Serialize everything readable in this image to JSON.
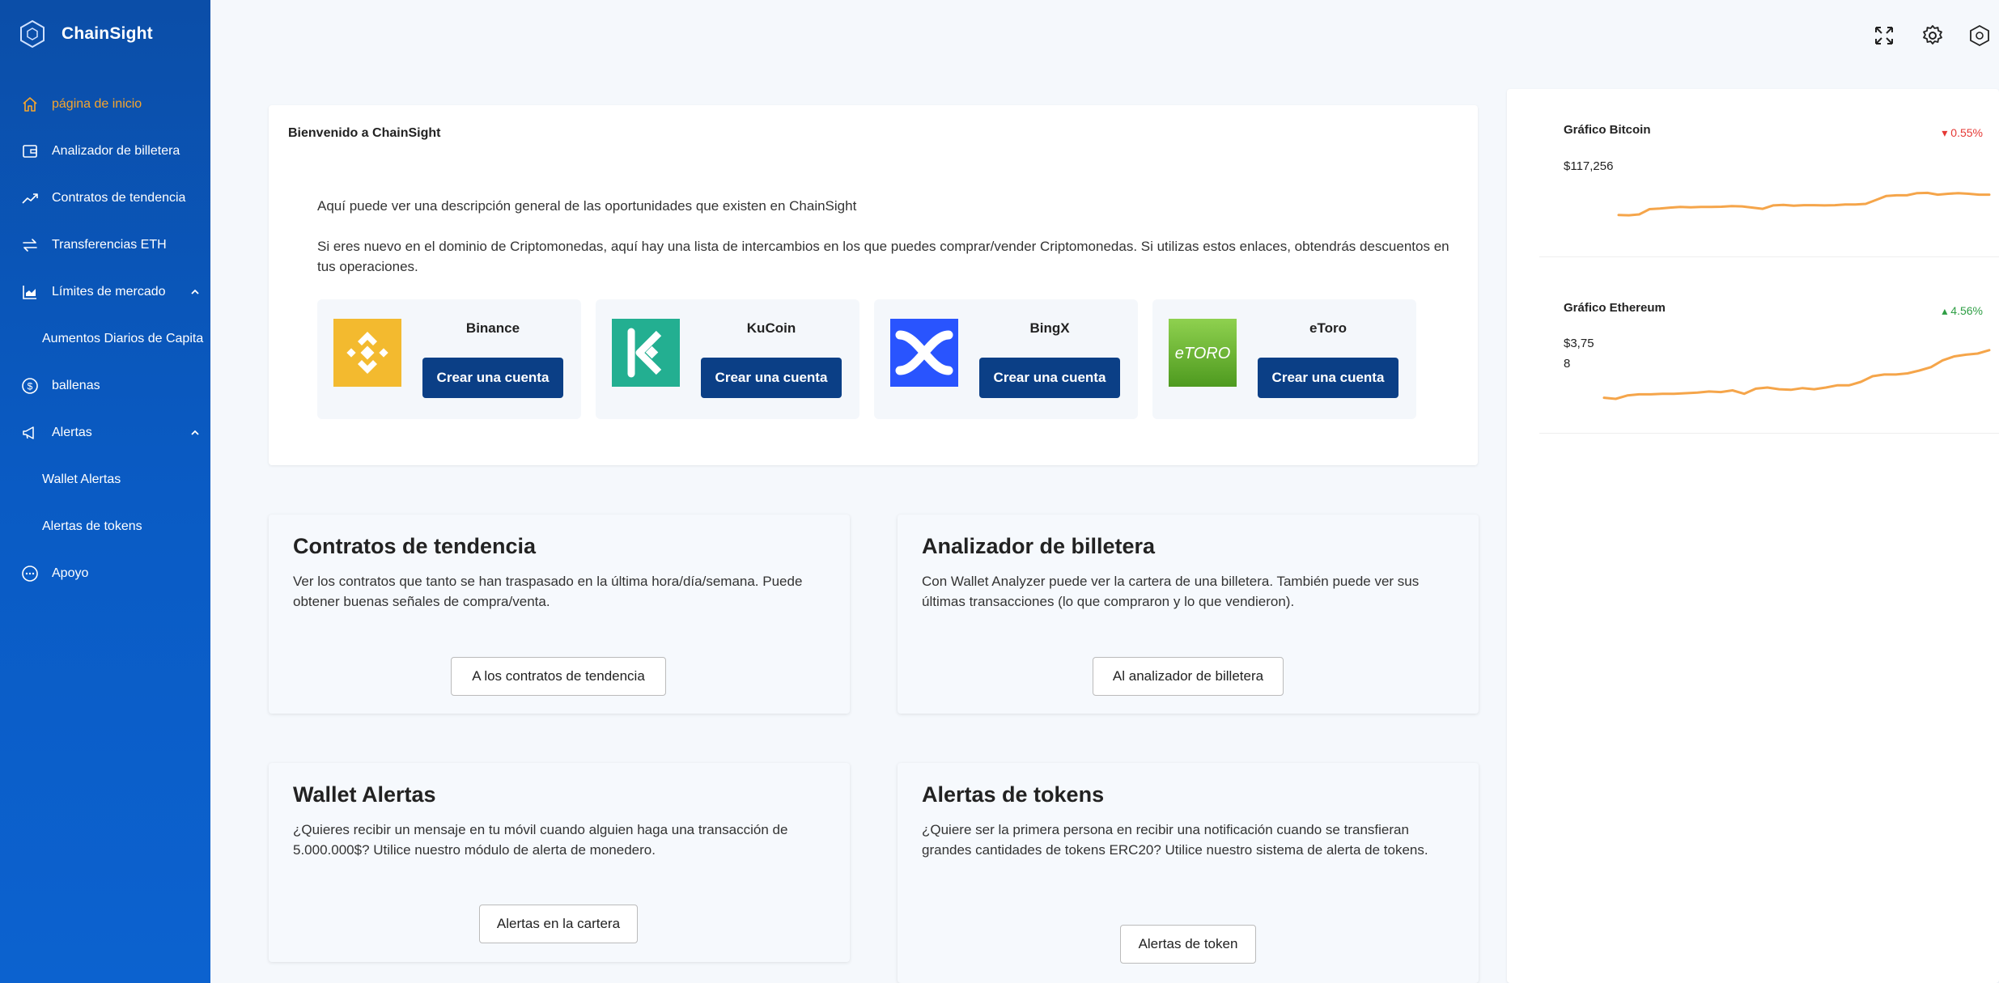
{
  "brand": {
    "name": "ChainSight"
  },
  "sidebar": {
    "items": [
      {
        "label": "página de inicio",
        "icon": "home-icon",
        "active": true
      },
      {
        "label": "Analizador de billetera",
        "icon": "wallet-icon"
      },
      {
        "label": "Contratos de tendencia",
        "icon": "trend-icon"
      },
      {
        "label": "Transferencias ETH",
        "icon": "transfer-icon"
      },
      {
        "label": "Límites de mercado",
        "icon": "chart-icon",
        "expanded": true
      },
      {
        "label": "Aumentos Diarios de Capita",
        "sub": true
      },
      {
        "label": "ballenas",
        "icon": "dollar-icon"
      },
      {
        "label": "Alertas",
        "icon": "megaphone-icon",
        "expanded": true
      },
      {
        "label": "Wallet Alertas",
        "sub": true
      },
      {
        "label": "Alertas de tokens",
        "sub": true
      },
      {
        "label": "Apoyo",
        "icon": "chat-icon"
      }
    ]
  },
  "topbar": {
    "icons": [
      "fullscreen-icon",
      "settings-icon",
      "theme-icon"
    ]
  },
  "welcome": {
    "title": "Bienvenido a ChainSight",
    "intro": "Aquí puede ver una descripción general de las oportunidades que existen en ChainSight",
    "body": "Si eres nuevo en el dominio de Criptomonedas, aquí hay una lista de intercambios en los que puedes comprar/vender Criptomonedas. Si utilizas estos enlaces, obtendrás descuentos en tus operaciones.",
    "exchanges": [
      {
        "name": "Binance",
        "button": "Crear una cuenta",
        "color": "#f3ba2f"
      },
      {
        "name": "KuCoin",
        "button": "Crear una cuenta",
        "color": "#23af91"
      },
      {
        "name": "BingX",
        "button": "Crear una cuenta",
        "color": "#2954fe"
      },
      {
        "name": "eToro",
        "button": "Crear una cuenta",
        "color": "#6ebd2c",
        "logo_text": "eTORO"
      }
    ]
  },
  "features": [
    {
      "title": "Contratos de tendencia",
      "text": "Ver los contratos que tanto se han traspasado en la última hora/día/semana. Puede obtener buenas señales de compra/venta.",
      "button": "A los contratos de tendencia"
    },
    {
      "title": "Analizador de billetera",
      "text": "Con Wallet Analyzer puede ver la cartera de una billetera. También puede ver sus últimas transacciones (lo que compraron y lo que vendieron).",
      "button": "Al analizador de billetera"
    },
    {
      "title": "Wallet Alertas",
      "text": "¿Quieres recibir un mensaje en tu móvil cuando alguien haga una transacción de 5.000.000$? Utilice nuestro módulo de alerta de monedero.",
      "button": "Alertas en la cartera"
    },
    {
      "title": "Alertas de tokens",
      "text": "¿Quiere ser la primera persona en recibir una notificación cuando se transfieran grandes cantidades de tokens ERC20? Utilice nuestro sistema de alerta de tokens.",
      "button": "Alertas de token"
    }
  ],
  "charts": [
    {
      "title": "Gráfico Bitcoin",
      "price_line1": "$117,256",
      "price_line2": "",
      "change": "0.55%",
      "direction": "down",
      "change_color": "#e53935",
      "line_color": "#f5a54a"
    },
    {
      "title": "Gráfico Ethereum",
      "price_line1": "$3,75",
      "price_line2": "8",
      "change": "4.56%",
      "direction": "up",
      "change_color": "#2e9e44",
      "line_color": "#f5a54a"
    }
  ],
  "chart_data": [
    {
      "type": "line",
      "title": "Gráfico Bitcoin",
      "values": [
        0.06,
        0.05,
        0.08,
        0.25,
        0.27,
        0.3,
        0.32,
        0.31,
        0.32,
        0.32,
        0.33,
        0.35,
        0.34,
        0.3,
        0.26,
        0.37,
        0.39,
        0.36,
        0.38,
        0.38,
        0.37,
        0.38,
        0.4,
        0.4,
        0.42,
        0.55,
        0.68,
        0.7,
        0.7,
        0.77,
        0.78,
        0.72,
        0.75,
        0.77,
        0.75,
        0.72,
        0.72
      ]
    },
    {
      "type": "line",
      "title": "Gráfico Ethereum",
      "values": [
        0.12,
        0.1,
        0.16,
        0.18,
        0.18,
        0.19,
        0.19,
        0.2,
        0.21,
        0.23,
        0.22,
        0.25,
        0.19,
        0.28,
        0.3,
        0.27,
        0.26,
        0.29,
        0.27,
        0.3,
        0.34,
        0.34,
        0.4,
        0.5,
        0.53,
        0.53,
        0.55,
        0.6,
        0.66,
        0.78,
        0.85,
        0.88,
        0.9,
        0.96
      ]
    }
  ]
}
